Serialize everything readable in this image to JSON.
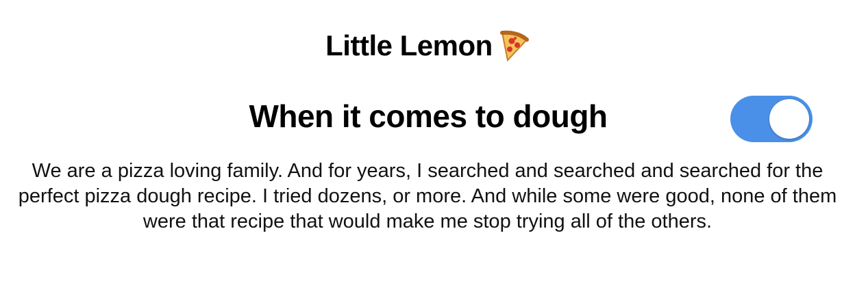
{
  "header": {
    "title": "Little Lemon",
    "title_icon": "pizza-slice-icon"
  },
  "section": {
    "title": "When it comes to dough",
    "toggle": {
      "state": "on",
      "color": "#4a90e8"
    },
    "body": "We are a pizza loving family. And for years, I searched and searched and searched for the perfect pizza dough recipe. I tried dozens, or more. And while some were good, none of them were that recipe that would make me stop trying all of the others."
  }
}
